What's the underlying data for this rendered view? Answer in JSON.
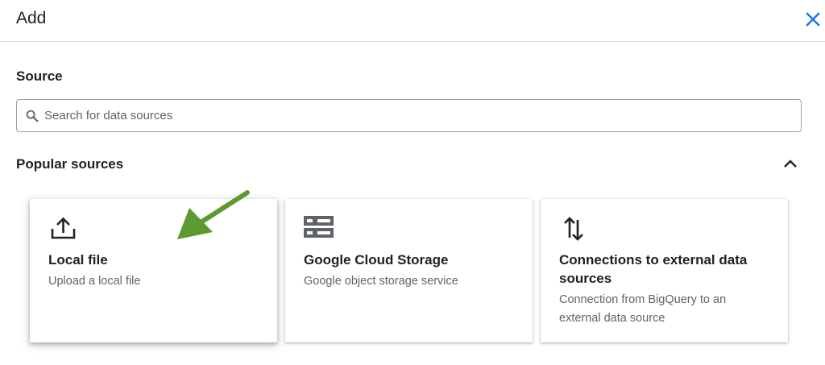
{
  "dialog": {
    "title": "Add",
    "close_icon": "close-icon",
    "accent_color": "#1a73e8"
  },
  "source": {
    "label": "Source",
    "search": {
      "placeholder": "Search for data sources",
      "value": "",
      "icon": "search-icon"
    }
  },
  "popular": {
    "label": "Popular sources",
    "toggle_icon": "chevron-up-icon",
    "cards": [
      {
        "icon": "upload-icon",
        "title": "Local file",
        "description": "Upload a local file"
      },
      {
        "icon": "storage-icon",
        "title": "Google Cloud Storage",
        "description": "Google object storage service"
      },
      {
        "icon": "swap-vertical-icon",
        "title": "Connections to external data sources",
        "description": "Connection from BigQuery to an external data source"
      }
    ]
  },
  "annotation": {
    "arrow_icon": "arrow-icon",
    "arrow_color": "#5a9a2e"
  }
}
